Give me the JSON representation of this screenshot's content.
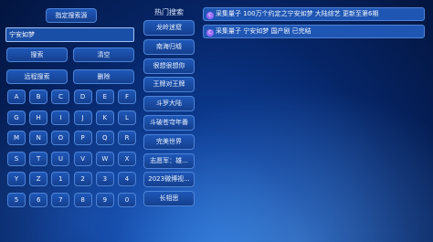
{
  "left_panel": {
    "specify_source_label": "指定搜索源",
    "search_value": "宁安如梦",
    "search_label": "搜索",
    "clear_label": "清空",
    "remote_search_label": "远程搜索",
    "delete_label": "删除"
  },
  "keyboard": {
    "keys": [
      "A",
      "B",
      "C",
      "D",
      "E",
      "F",
      "G",
      "H",
      "I",
      "J",
      "K",
      "L",
      "M",
      "N",
      "O",
      "P",
      "Q",
      "R",
      "S",
      "T",
      "U",
      "V",
      "W",
      "X",
      "Y",
      "Z",
      "1",
      "2",
      "3",
      "4",
      "5",
      "6",
      "7",
      "8",
      "9",
      "0"
    ]
  },
  "hot_search": {
    "title": "热门搜索",
    "items": [
      "龙岭迷窟",
      "南海归墟",
      "很想很想你",
      "王牌对王牌",
      "斗罗大陆",
      "斗破苍穹年番",
      "完美世界",
      "志愿军：雄...",
      "2023微博视...",
      "长相思"
    ]
  },
  "results": {
    "icon_glyph": "C",
    "items": [
      "采集量子 100万个约定之宁安如梦 大陆综艺 更新至第6期",
      "采集量子 宁安如梦 国产剧 已完结"
    ]
  }
}
